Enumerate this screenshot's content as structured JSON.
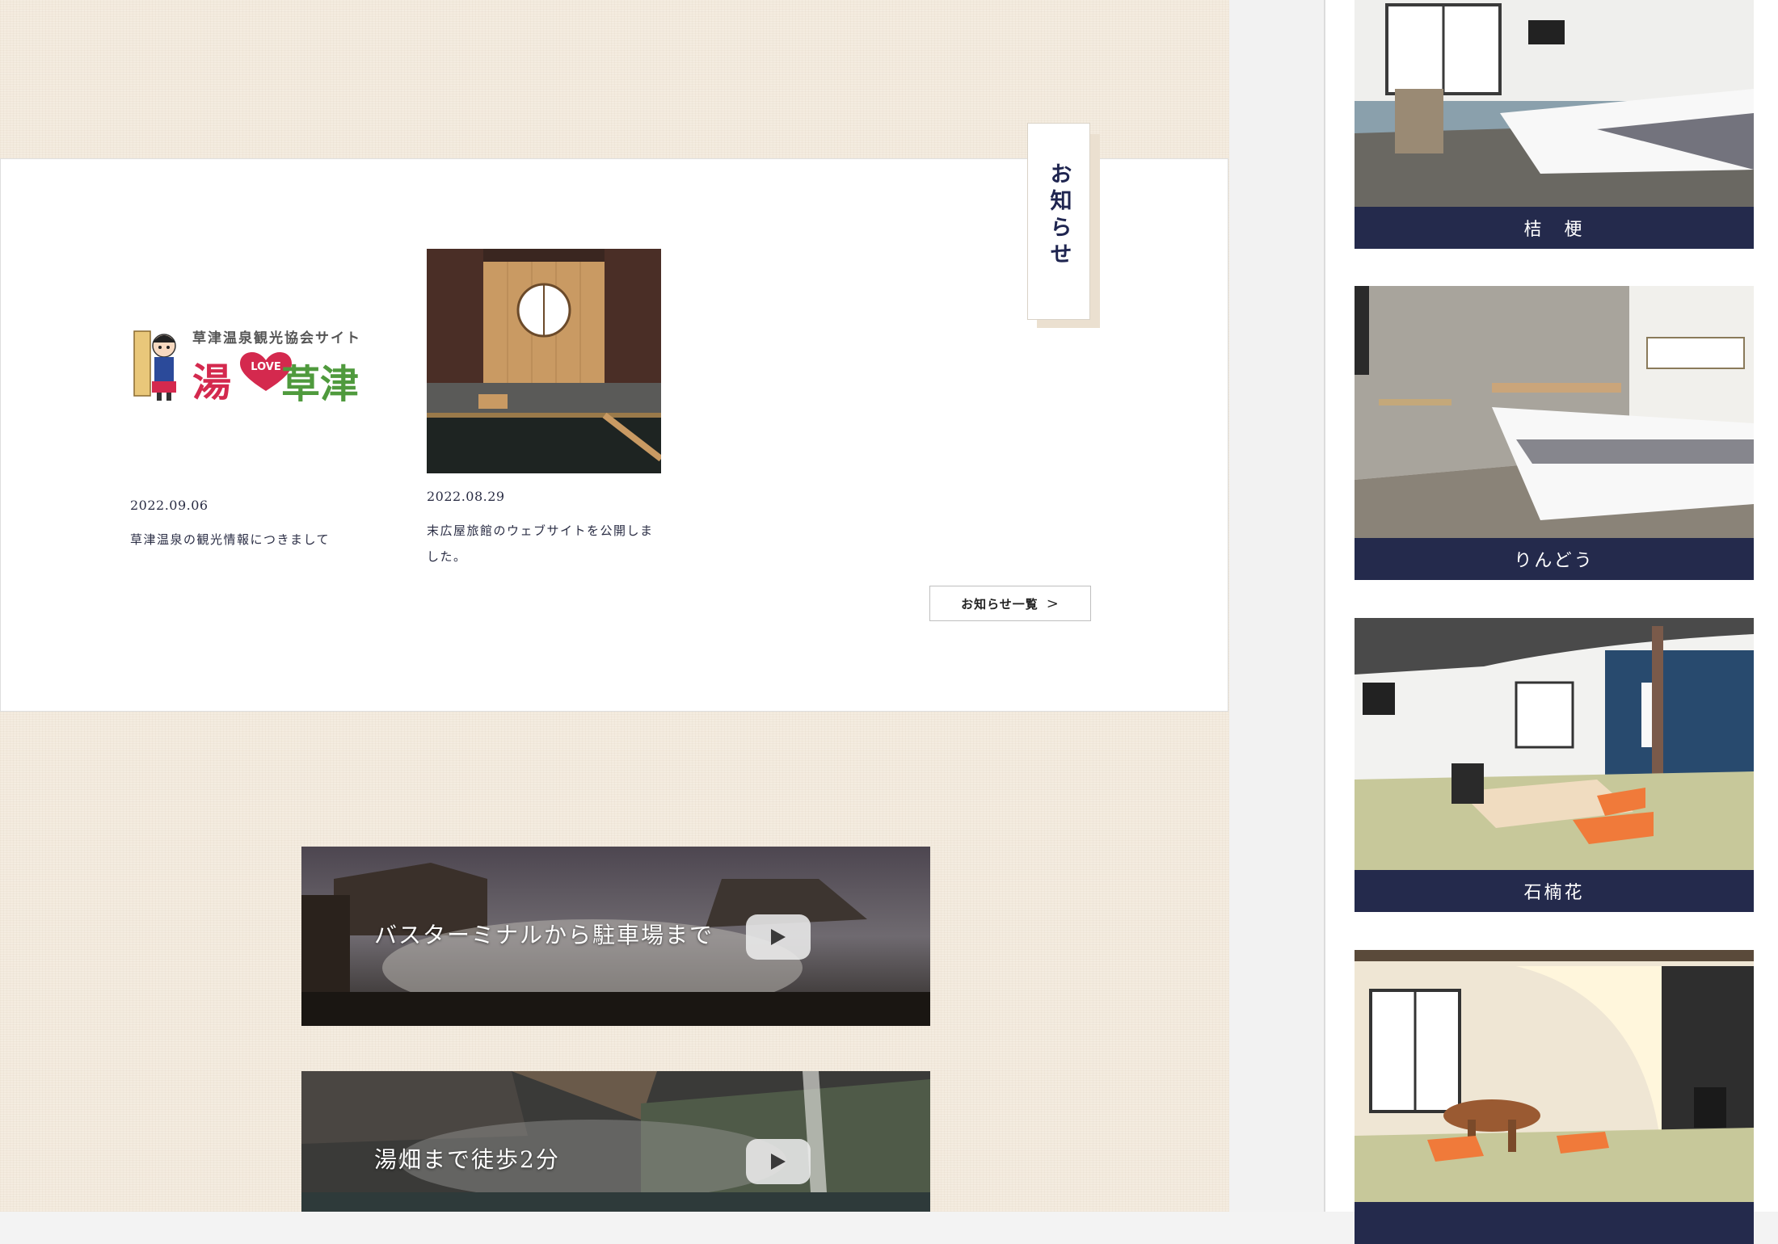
{
  "news": {
    "heading": "お知らせ",
    "items": [
      {
        "date": "2022.09.06",
        "title": "草津温泉の観光情報につきまして",
        "logo": {
          "subtitle": "草津温泉観光協会サイト",
          "yu": "湯",
          "love": "LOVE",
          "kusatsu": "草津"
        }
      },
      {
        "date": "2022.08.29",
        "title_lines": [
          "末広屋旅館のウェブサイトを公開しま",
          "した。"
        ]
      }
    ],
    "more_button": {
      "label": "お知らせ一覧",
      "arrow": ">"
    }
  },
  "videos": [
    {
      "label": "バスターミナルから駐車場まで",
      "icon": "play-icon"
    },
    {
      "label": "湯畑まで徒歩2分",
      "icon": "play-icon"
    }
  ],
  "rooms": [
    {
      "name": "桔　梗"
    },
    {
      "name": "りんどう"
    },
    {
      "name": "石楠花"
    },
    {
      "name": ""
    }
  ],
  "colors": {
    "navy": "#242a4c",
    "page_bg": "#f4ece0",
    "heading": "#1f2550",
    "logo_red": "#d4294e",
    "logo_green": "#4f9a3d"
  }
}
